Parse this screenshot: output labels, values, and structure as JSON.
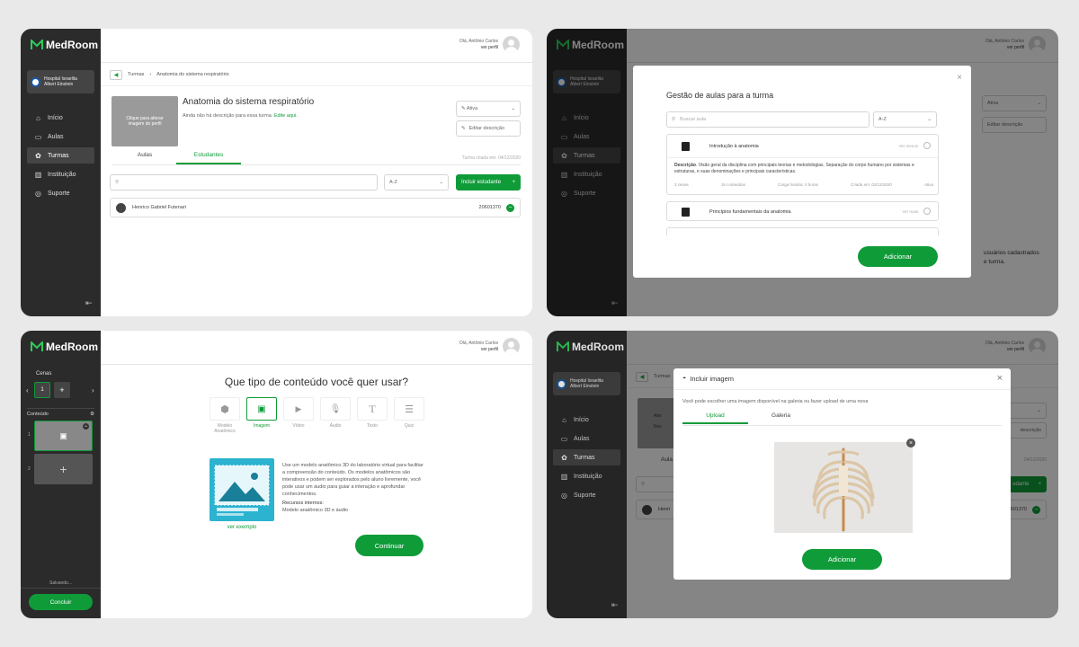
{
  "brand": {
    "name": "MedRoom",
    "accent": "#109b39",
    "sidebar_bg": "#2b2b2b"
  },
  "user": {
    "greeting": "Olá, Antônio Carlos",
    "profile_link": "ver perfil"
  },
  "hospital": {
    "line1": "Hospital Israelita",
    "line2": "Albert Einstein"
  },
  "nav": [
    {
      "label": "Início",
      "icon": "home-icon"
    },
    {
      "label": "Aulas",
      "icon": "book-icon"
    },
    {
      "label": "Turmas",
      "icon": "people-icon"
    },
    {
      "label": "Instituição",
      "icon": "building-icon"
    },
    {
      "label": "Suporte",
      "icon": "support-icon"
    }
  ],
  "screen1": {
    "breadcrumb": {
      "parent": "Turmas",
      "separator": "›",
      "current": "Anatomia do sistema respiratório"
    },
    "image_placeholder": "Clique para alterar imagem do perfil",
    "class_title": "Anatomia do sistema respiratório",
    "description_prefix": "Ainda não há descrição para essa turma.",
    "description_link": "Edite aqui.",
    "status_select": "Ativa",
    "edit_description": "Editar descrição",
    "tabs": [
      "Aulas",
      "Estudantes"
    ],
    "created": "Turma criada em: 04/12/2020",
    "sort": "A-Z",
    "add_student": "Incluir estudante",
    "students": [
      {
        "name": "Henrico Gabriel Futenari",
        "id": "20601370"
      }
    ]
  },
  "screen2": {
    "title": "Gestão de aulas para a turma",
    "search_placeholder": "Buscar aula",
    "sort": "A-Z",
    "lessons": [
      {
        "title": "Introdução à anatomia",
        "action": "Ver menos",
        "description_label": "Descrição",
        "description": "Visão geral da disciplina com principais teorias e metodologias. Separação do corpo humano por sistemas e estruturas, e suas denominações e principais características.",
        "scenes": "3 cenas",
        "contents": "15 conteúdos",
        "hours": "Carga horária: 4 horas",
        "created": "Criada em: 02/12/2020",
        "status": "Ativa"
      },
      {
        "title": "Princípios fundamentais da anatomia",
        "action": "Ver mais"
      }
    ],
    "add_button": "Adicionar",
    "bg": {
      "status": "Ativa",
      "edit": "Editar descrição",
      "text1": "usuários cadastrados",
      "text2": "e turma.",
      "date": "04/12/2020"
    }
  },
  "screen3": {
    "scenes_label": "Cenas",
    "current_scene": "1",
    "plus": "+",
    "content_label": "Conteúdo",
    "items": [
      "1",
      "2"
    ],
    "saving": "Salvando...",
    "finish": "Concluir",
    "question": "Que tipo de conteúdo você quer usar?",
    "types": [
      {
        "label": "Modelo Anatômico",
        "icon": "cube-icon"
      },
      {
        "label": "Imagem",
        "icon": "image-icon"
      },
      {
        "label": "Vídeo",
        "icon": "video-icon"
      },
      {
        "label": "Áudio",
        "icon": "microphone-icon"
      },
      {
        "label": "Texto",
        "icon": "text-icon"
      },
      {
        "label": "Quiz",
        "icon": "list-icon"
      }
    ],
    "info": "Use um modelo anatômico 3D do laboratório virtual para facilitar a compreensão do conteúdo. Os modelos anatômicos são interativos e podem ser explorados pelo aluno livremente, você pode usar um áudio para guiar a interação e aprofundar conhecimentos.",
    "resources_label": "Recursos internos:",
    "resources": "Modelo anatômico 3D e áudio",
    "example_link": "ver exemplo",
    "continue": "Continuar"
  },
  "screen4": {
    "title": "Incluir imagem",
    "subtitle": "Você pode escolher uma imagem disponível na galeria ou fazer upload de uma nova",
    "tabs": [
      "Upload",
      "Galeria"
    ],
    "add_button": "Adicionar",
    "bg": {
      "crumb": "Turmas",
      "tab": "Aula",
      "option1": "Ativ",
      "option2": "Nov",
      "edit": "descrição",
      "date": "04/12/2020",
      "button": "udante",
      "student": "Henri",
      "id": "601370"
    }
  }
}
